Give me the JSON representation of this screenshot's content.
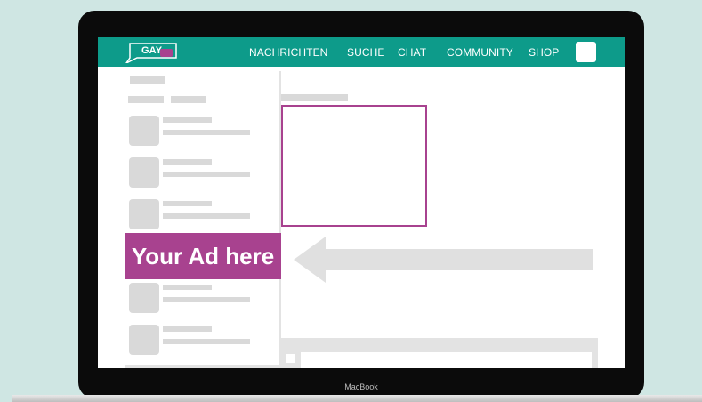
{
  "nav": {
    "logo_text": "GAY",
    "items": [
      "NACHRICHTEN",
      "SUCHE",
      "CHAT",
      "COMMUNITY",
      "SHOP"
    ]
  },
  "ad_label": "Your Ad here",
  "device_label": "MacBook",
  "colors": {
    "background": "#cfe6e3",
    "nav": "#0d9b8a",
    "accent": "#a8428f",
    "placeholder": "#d9d9d9"
  }
}
